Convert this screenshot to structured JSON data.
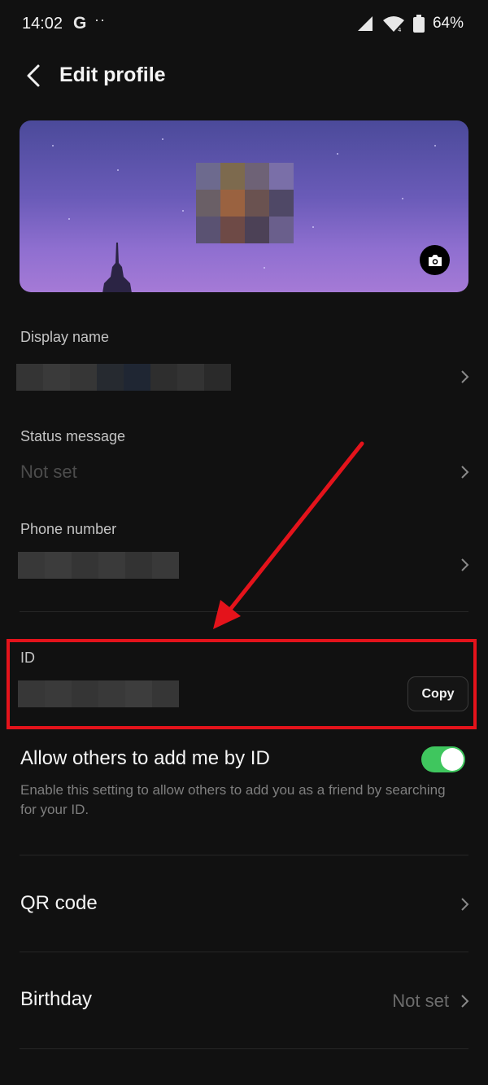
{
  "status_bar": {
    "time": "14:02",
    "google_letter": "G",
    "dots": "··",
    "battery": "64%"
  },
  "header": {
    "title": "Edit profile"
  },
  "fields": {
    "display_name": {
      "label": "Display name"
    },
    "status_message": {
      "label": "Status message",
      "value": "Not set"
    },
    "phone_number": {
      "label": "Phone number"
    },
    "id": {
      "label": "ID",
      "copy_label": "Copy"
    }
  },
  "allow_by_id": {
    "title": "Allow others to add me by ID",
    "description": "Enable this setting to allow others to add you as a friend by searching for your ID.",
    "enabled": true
  },
  "rows": {
    "qr_code": {
      "title": "QR code"
    },
    "birthday": {
      "title": "Birthday",
      "value": "Not set"
    }
  },
  "colors": {
    "background": "#111111",
    "highlight": "#e4131b",
    "toggle_on": "#3fc65e"
  },
  "icons": [
    "back-arrow-icon",
    "camera-icon",
    "chevron-right-icon",
    "signal-icon",
    "wifi-icon",
    "battery-icon"
  ]
}
